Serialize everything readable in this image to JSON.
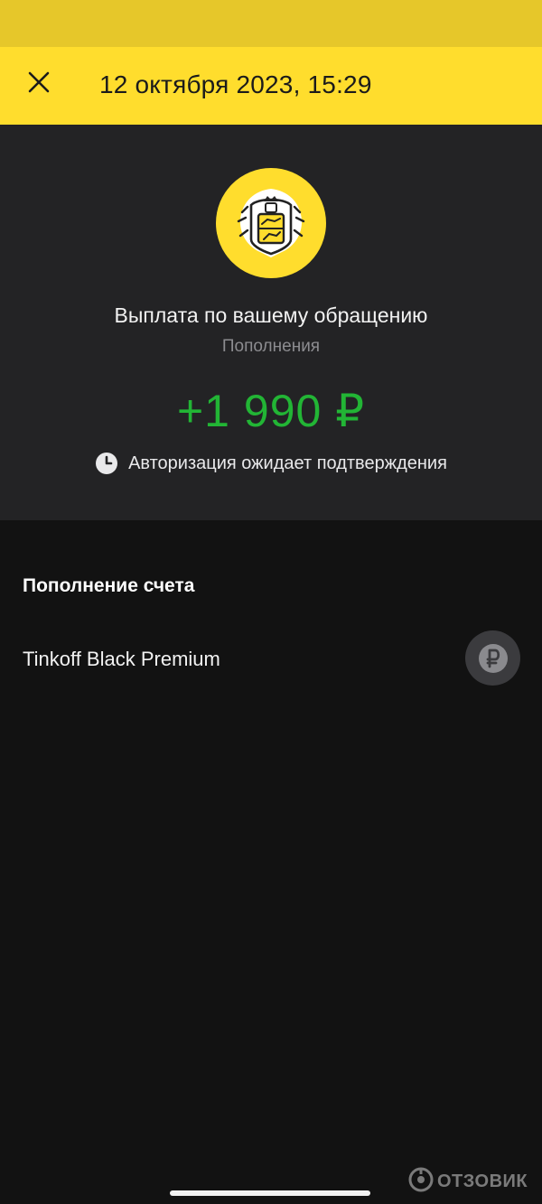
{
  "header": {
    "title": "12 октября 2023, 15:29",
    "close_icon": "close-icon"
  },
  "operation": {
    "logo": "tinkoff-logo-icon",
    "title": "Выплата по вашему обращению",
    "category": "Пополнения",
    "amount": "+1 990 ₽",
    "status_icon": "clock-icon",
    "status": "Авторизация ожидает подтверждения"
  },
  "account_section": {
    "title": "Пополнение счета",
    "account_name": "Tinkoff Black Premium",
    "account_icon": "ruble-icon"
  },
  "watermark": {
    "text": "ОТЗОВИК"
  },
  "colors": {
    "brand_yellow": "#ffdd2d",
    "status_bar": "#e6c72a",
    "amount_green": "#22b535",
    "summary_bg": "#232325",
    "page_bg": "#121212"
  }
}
